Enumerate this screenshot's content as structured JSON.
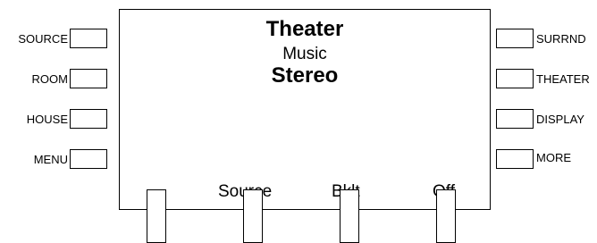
{
  "left_buttons": [
    {
      "label": "SOURCE"
    },
    {
      "label": "ROOM"
    },
    {
      "label": "HOUSE"
    },
    {
      "label": "MENU"
    }
  ],
  "right_buttons": [
    {
      "label": "SURRND"
    },
    {
      "label": "THEATER"
    },
    {
      "label": "DISPLAY"
    },
    {
      "label": "MORE"
    }
  ],
  "display": {
    "line1": "Theater",
    "line2": "Music",
    "line3": "Stereo",
    "softkeys": [
      "Source",
      "Bklt",
      "Off",
      ""
    ]
  }
}
